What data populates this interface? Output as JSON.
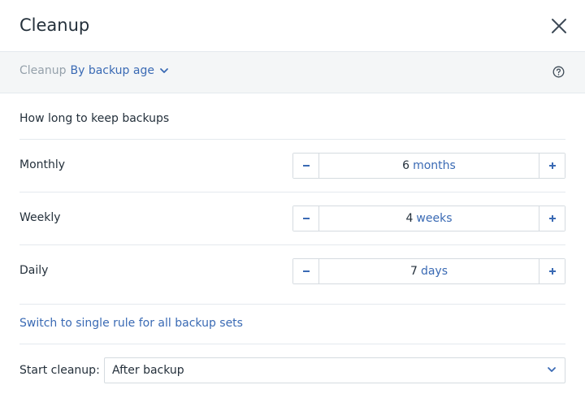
{
  "header": {
    "title": "Cleanup",
    "close_icon": "close-icon"
  },
  "subbar": {
    "prefix": "Cleanup",
    "mode_value": "By backup age",
    "dropdown_icon": "chevron-down-icon",
    "help_icon": "help-circle-icon"
  },
  "section": {
    "heading": "How long to keep backups"
  },
  "rows": [
    {
      "label": "Monthly",
      "number": "6",
      "unit": "months"
    },
    {
      "label": "Weekly",
      "number": "4",
      "unit": "weeks"
    },
    {
      "label": "Daily",
      "number": "7",
      "unit": "days"
    }
  ],
  "switch_link": "Switch to single rule for all backup sets",
  "start_cleanup": {
    "label": "Start cleanup:",
    "value": "After backup"
  },
  "colors": {
    "accent": "#3a6ab4",
    "text": "#24303b",
    "muted": "#95a1ab",
    "subbar_bg": "#f4f6f7",
    "border": "#d5dbe0"
  }
}
